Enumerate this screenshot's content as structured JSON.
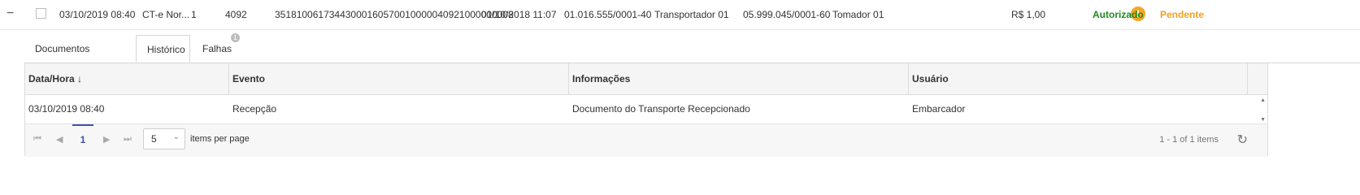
{
  "row": {
    "collapse_symbol": "−",
    "date": "03/10/2019 08:40",
    "type": "CT-e Nor...",
    "series": "1",
    "number": "4092",
    "access_key": "35181006173443000160570010000040921000000008",
    "emission": "01/10/2018 11:07",
    "carrier_cnpj": "01.016.555/0001-40",
    "carrier_name": "Transportador 01",
    "taker_cnpj": "05.999.045/0001-60",
    "taker_name": "Tomador 01",
    "value": "R$ 1,00",
    "warning_symbol": "!",
    "status": "Autorizado",
    "status2": "Pendente"
  },
  "tabs": [
    {
      "label": "Documentos Originários"
    },
    {
      "label": "Histórico"
    },
    {
      "label": "Falhas",
      "badge": "1"
    }
  ],
  "grid": {
    "columns": [
      "Data/Hora ↓",
      "Evento",
      "Informações",
      "Usuário"
    ],
    "rows": [
      [
        "03/10/2019 08:40",
        "Recepção",
        "Documento do Transporte Recepcionado",
        "Embarcador"
      ]
    ]
  },
  "pager": {
    "current_page": "1",
    "page_size": "5",
    "items_per_page_label": "items per page",
    "info": "1 - 1 of 1 items"
  },
  "icons": {
    "first": "⏮",
    "prev": "◀",
    "next": "▶",
    "last": "⏭",
    "chevron": "⌄",
    "refresh": "↻",
    "scroll_up": "▲",
    "scroll_down": "▼"
  }
}
